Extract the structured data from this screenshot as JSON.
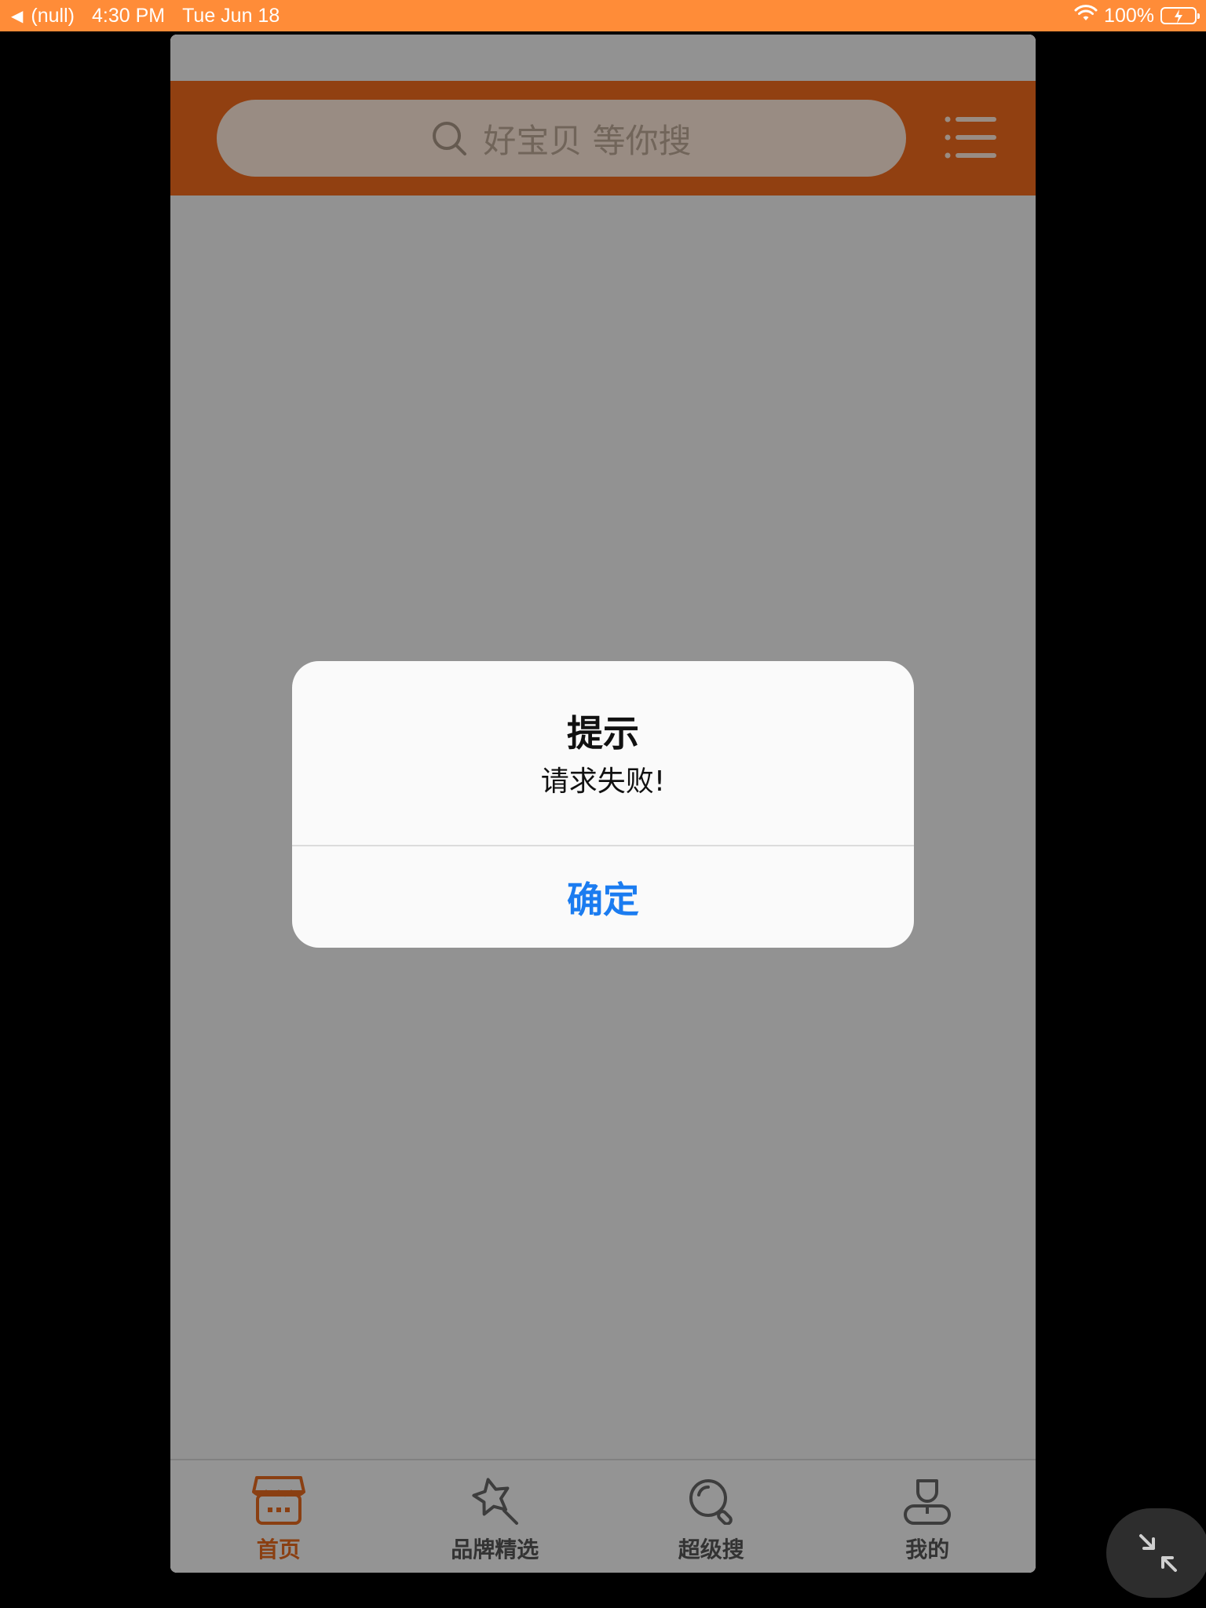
{
  "status_bar": {
    "back_glyph": "◀",
    "back_label": "(null)",
    "time": "4:30 PM",
    "date": "Tue Jun 18",
    "battery_text": "100%",
    "icons": [
      "wifi-icon",
      "battery-charging-icon"
    ]
  },
  "header": {
    "search_placeholder": "好宝贝 等你搜",
    "icons": [
      "search-icon",
      "list-menu-icon"
    ]
  },
  "tabbar": {
    "tabs": [
      {
        "label": "首页",
        "icon": "shop-icon",
        "active": true
      },
      {
        "label": "品牌精选",
        "icon": "star-search-icon",
        "active": false
      },
      {
        "label": "超级搜",
        "icon": "magnifier-icon",
        "active": false
      },
      {
        "label": "我的",
        "icon": "person-icon",
        "active": false
      }
    ]
  },
  "alert": {
    "title": "提示",
    "message": "请求失败!",
    "confirm_label": "确定"
  },
  "colors": {
    "status_bar": "#FF8C38",
    "header": "#F26B1D",
    "active_tab": "#E76A1E",
    "alert_button": "#1B7CF0"
  }
}
